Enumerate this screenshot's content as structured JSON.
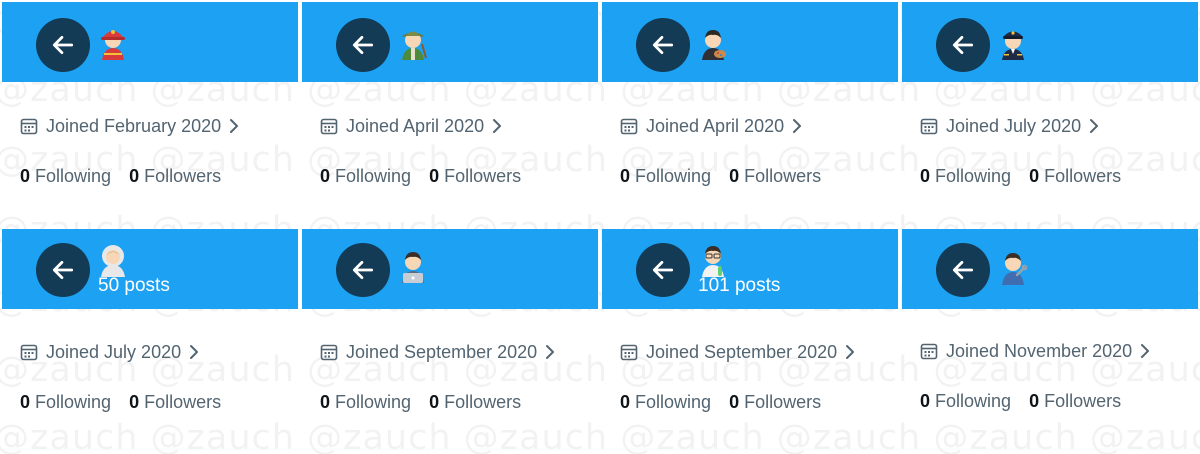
{
  "watermark": "@zauch @zauch @zauch @zauch @zauch @zauch @zauch @zauch @zauch @zauch",
  "colors": {
    "banner": "#1da1f2",
    "muted_text": "#536471",
    "strong_text": "#0f1419"
  },
  "cards": [
    {
      "avatar_icon": "firefighter-emoji",
      "posts": "",
      "joined": "Joined February 2020",
      "following_count": "0",
      "following_label": "Following",
      "followers_count": "0",
      "followers_label": "Followers"
    },
    {
      "avatar_icon": "farmer-emoji",
      "posts": "",
      "joined": "Joined April 2020",
      "following_count": "0",
      "following_label": "Following",
      "followers_count": "0",
      "followers_label": "Followers"
    },
    {
      "avatar_icon": "artist-emoji",
      "posts": "",
      "joined": "Joined April 2020",
      "following_count": "0",
      "following_label": "Following",
      "followers_count": "0",
      "followers_label": "Followers"
    },
    {
      "avatar_icon": "pilot-emoji",
      "posts": "",
      "joined": "Joined July 2020",
      "following_count": "0",
      "following_label": "Following",
      "followers_count": "0",
      "followers_label": "Followers"
    },
    {
      "avatar_icon": "astronaut-emoji",
      "posts": "50 posts",
      "joined": "Joined July 2020",
      "following_count": "0",
      "following_label": "Following",
      "followers_count": "0",
      "followers_label": "Followers"
    },
    {
      "avatar_icon": "technologist-emoji",
      "posts": "",
      "joined": "Joined September 2020",
      "following_count": "0",
      "following_label": "Following",
      "followers_count": "0",
      "followers_label": "Followers"
    },
    {
      "avatar_icon": "scientist-emoji",
      "posts": "101 posts",
      "joined": "Joined September 2020",
      "following_count": "0",
      "following_label": "Following",
      "followers_count": "0",
      "followers_label": "Followers"
    },
    {
      "avatar_icon": "mechanic-emoji",
      "posts": "",
      "joined": "Joined November 2020",
      "following_count": "0",
      "following_label": "Following",
      "followers_count": "0",
      "followers_label": "Followers"
    }
  ]
}
